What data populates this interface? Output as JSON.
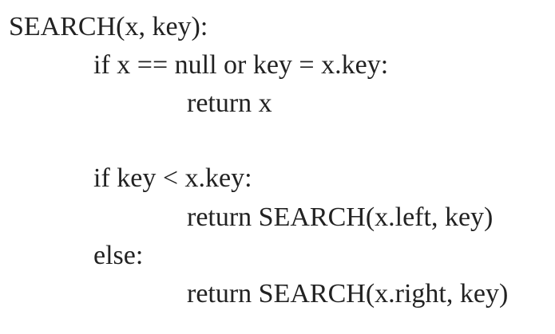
{
  "document": {
    "lines": [
      "SEARCH(x, key):",
      "if x == null or key = x.key:",
      "return x",
      "if key < x.key:",
      "return SEARCH(x.left, key)",
      "else:",
      "return SEARCH(x.right, key)"
    ]
  }
}
